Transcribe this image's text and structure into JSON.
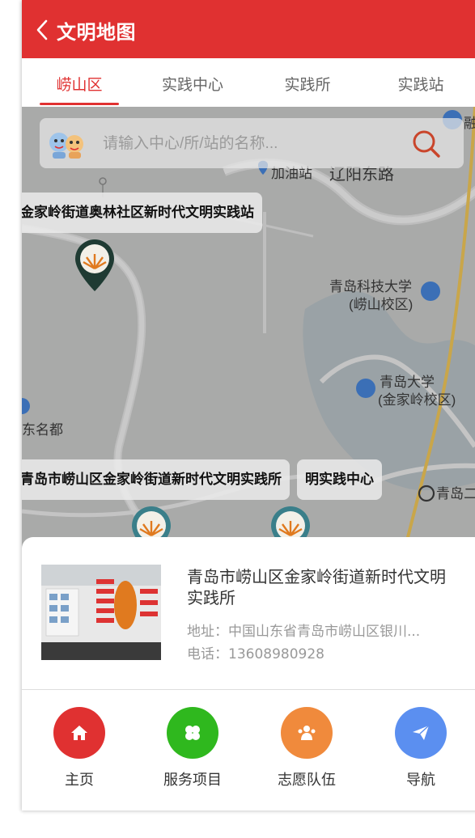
{
  "header": {
    "title": "文明地图",
    "back_icon": "chevron-left-icon",
    "color": "#e03131"
  },
  "tabs": [
    {
      "label": "崂山区",
      "active": true
    },
    {
      "label": "实践中心",
      "active": false
    },
    {
      "label": "实践所",
      "active": false
    },
    {
      "label": "实践站",
      "active": false
    }
  ],
  "search": {
    "placeholder": "请输入中心/所/站的名称...",
    "icon": "search-icon"
  },
  "map": {
    "labels": {
      "gas_station": "加油站",
      "road": "辽阳东路",
      "university_1_line1": "青岛科技大学",
      "university_1_line2": "(崂山校区)",
      "university_2_line1": "青岛大学",
      "university_2_line2": "(金家岭校区)",
      "east_mingdu": "东名都",
      "partial_right_top": "融",
      "partial_right_bottom": "青岛二"
    },
    "markers": [
      {
        "label": "金家岭街道奥林社区新时代文明实践站"
      },
      {
        "label": "青岛市崂山区金家岭街道新时代文明实践所"
      },
      {
        "label": "明实践中心"
      }
    ]
  },
  "place": {
    "name": "青岛市崂山区金家岭街道新时代文明实践所",
    "address": "地址：中国山东省青岛市崂山区银川...",
    "phone": "电话：13608980928"
  },
  "bottom_nav": [
    {
      "label": "主页",
      "icon": "home-icon",
      "color": "#e03131"
    },
    {
      "label": "服务项目",
      "icon": "clover-icon",
      "color": "#2fb81e"
    },
    {
      "label": "志愿队伍",
      "icon": "team-icon",
      "color": "#f08a3c"
    },
    {
      "label": "导航",
      "icon": "paper-plane-icon",
      "color": "#5b8ff0"
    }
  ]
}
